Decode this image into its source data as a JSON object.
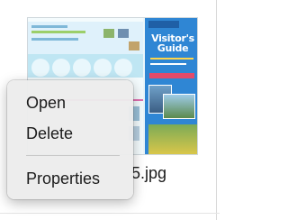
{
  "file": {
    "name_visible": "5.jpg"
  },
  "thumbnail": {
    "title": "Visitor's Guide"
  },
  "context_menu": {
    "items": [
      {
        "label": "Open"
      },
      {
        "label": "Delete"
      },
      {
        "label": "Properties"
      }
    ]
  },
  "colors": {
    "menu_background": "#ececec",
    "menu_text": "#1c1c1c",
    "separator": "#c8c8c8",
    "thumbnail_accent": "#2f86d4"
  }
}
